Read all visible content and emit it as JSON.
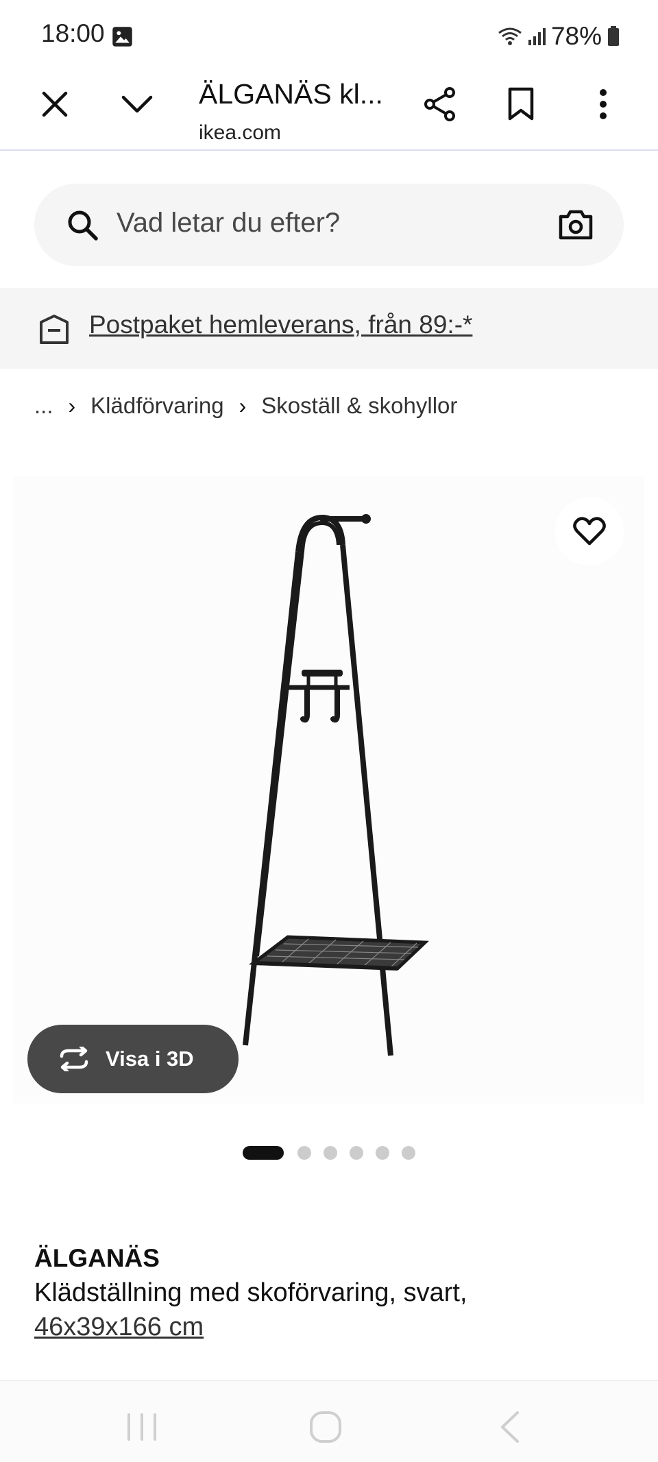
{
  "status_bar": {
    "time": "18:00",
    "battery": "78%"
  },
  "browser": {
    "title": "ÄLGANÄS kl...",
    "domain": "ikea.com"
  },
  "search": {
    "placeholder": "Vad letar du efter?"
  },
  "delivery_banner": {
    "text": "Postpaket hemleverans, från 89:-*"
  },
  "breadcrumb": {
    "ellipsis": "...",
    "items": [
      "Klädförvaring",
      "Skoställ & skohyllor"
    ]
  },
  "product_media": {
    "view_3d_label": "Visa i 3D",
    "image_count": 6,
    "active_image": 1
  },
  "product": {
    "name": "ÄLGANÄS",
    "description": "Klädställning med skoförvaring, svart,",
    "size": "46x39x166 cm"
  },
  "icons": {
    "close": "close-icon",
    "chevron": "chevron-down-icon",
    "share": "share-icon",
    "bookmark": "bookmark-icon",
    "more": "more-vertical-icon",
    "search": "search-icon",
    "camera": "camera-icon",
    "delivery": "delivery-box-icon",
    "favorite": "heart-icon",
    "rotate3d": "rotate-3d-icon"
  },
  "colors": {
    "background": "#ffffff",
    "search_bg": "#f5f5f5",
    "view_3d_bg": "#484848",
    "dot_active": "#111111",
    "dot_inactive": "#cccccc"
  }
}
